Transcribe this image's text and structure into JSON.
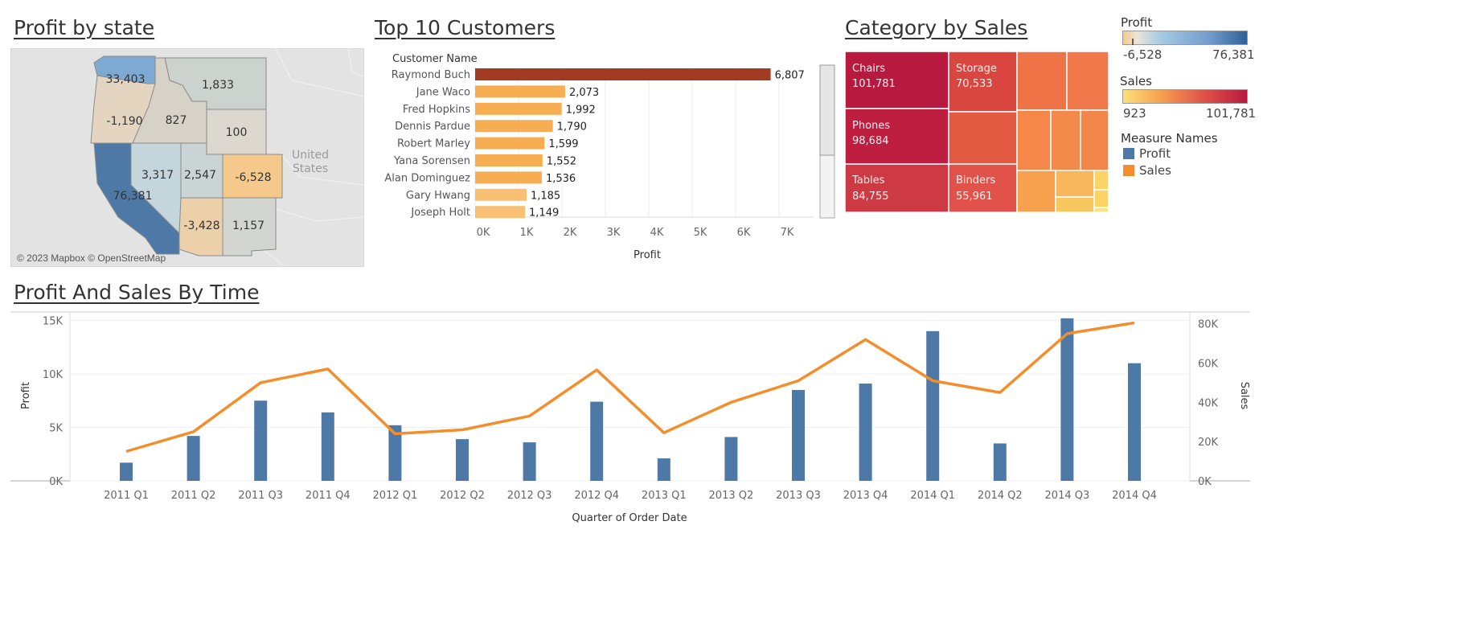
{
  "titles": {
    "map": "Profit by state",
    "customers": "Top 10 Customers",
    "category": "Category by Sales",
    "time": "Profit And Sales By Time"
  },
  "map": {
    "attribution": "© 2023 Mapbox © OpenStreetMap",
    "country_label": [
      "United",
      "States"
    ],
    "states": [
      {
        "name": "Washington",
        "profit": "33,403",
        "color": "#7ea9d3"
      },
      {
        "name": "Oregon",
        "profit": "-1,190",
        "color": "#e4d5c0"
      },
      {
        "name": "California",
        "profit": "76,381",
        "color": "#4e79a7"
      },
      {
        "name": "Idaho",
        "profit": "827",
        "color": "#d7d2c7"
      },
      {
        "name": "Montana",
        "profit": "1,833",
        "color": "#ccd3cf"
      },
      {
        "name": "Wyoming",
        "profit": "100",
        "color": "#dcd8cf"
      },
      {
        "name": "Nevada",
        "profit": "3,317",
        "color": "#c5d5dc"
      },
      {
        "name": "Utah",
        "profit": "2,547",
        "color": "#cad4d4"
      },
      {
        "name": "Colorado",
        "profit": "-6,528",
        "color": "#f5c98c"
      },
      {
        "name": "Arizona",
        "profit": "-3,428",
        "color": "#ecd0aa"
      },
      {
        "name": "New Mexico",
        "profit": "1,157",
        "color": "#d2d5d0"
      }
    ]
  },
  "customers_chart": {
    "row_header": "Customer Name",
    "x_axis_title": "Profit",
    "ticks": [
      "0K",
      "1K",
      "2K",
      "3K",
      "4K",
      "5K",
      "6K",
      "7K"
    ]
  },
  "treemap": {
    "tiles": [
      {
        "name": "Chairs",
        "value": "101,781"
      },
      {
        "name": "Storage",
        "value": "70,533"
      },
      {
        "name": "Phones",
        "value": "98,684"
      },
      {
        "name": "Tables",
        "value": "84,755"
      },
      {
        "name": "Binders",
        "value": "55,961"
      }
    ]
  },
  "legend": {
    "profit_title": "Profit",
    "profit_min": "-6,528",
    "profit_max": "76,381",
    "sales_title": "Sales",
    "sales_min": "923",
    "sales_max": "101,781",
    "measure_title": "Measure Names",
    "measure_items": [
      {
        "label": "Profit",
        "color": "#4e79a7"
      },
      {
        "label": "Sales",
        "color": "#f28e2b"
      }
    ]
  },
  "time_chart": {
    "x_axis_title": "Quarter of Order Date",
    "left_axis_title": "Profit",
    "right_axis_title": "Sales",
    "left_ticks": [
      "0K",
      "5K",
      "10K",
      "15K"
    ],
    "right_ticks": [
      "0K",
      "20K",
      "40K",
      "60K",
      "80K"
    ]
  },
  "chart_data": [
    {
      "type": "bar",
      "title": "Top 10 Customers",
      "xlabel": "Profit",
      "ylabel": "Customer Name",
      "orientation": "horizontal",
      "xlim": [
        0,
        8000
      ],
      "categories": [
        "Raymond Buch",
        "Jane Waco",
        "Fred Hopkins",
        "Dennis Pardue",
        "Robert Marley",
        "Yana Sorensen",
        "Alan Dominguez",
        "Gary Hwang",
        "Joseph Holt"
      ],
      "values": [
        6807,
        2073,
        1992,
        1790,
        1599,
        1552,
        1536,
        1185,
        1149
      ],
      "value_labels": [
        "6,807",
        "2,073",
        "1,992",
        "1,790",
        "1,599",
        "1,552",
        "1,536",
        "1,185",
        "1,149"
      ]
    },
    {
      "type": "bar",
      "title": "Profit And Sales By Time",
      "xlabel": "Quarter of Order Date",
      "categories": [
        "2011 Q1",
        "2011 Q2",
        "2011 Q3",
        "2011 Q4",
        "2012 Q1",
        "2012 Q2",
        "2012 Q3",
        "2012 Q4",
        "2013 Q1",
        "2013 Q2",
        "2013 Q3",
        "2013 Q4",
        "2014 Q1",
        "2014 Q2",
        "2014 Q3",
        "2014 Q4"
      ],
      "series": [
        {
          "name": "Profit",
          "type": "bar",
          "axis": "left",
          "color": "#4e79a7",
          "values": [
            1700,
            4200,
            7500,
            6400,
            5200,
            3900,
            3600,
            7400,
            2100,
            4100,
            8500,
            9100,
            14000,
            3500,
            15200,
            11000
          ]
        },
        {
          "name": "Sales",
          "type": "line",
          "axis": "right",
          "color": "#f28e2b",
          "values": [
            15000,
            25000,
            50000,
            57000,
            24000,
            26000,
            33000,
            56500,
            24500,
            40000,
            51000,
            72000,
            51000,
            45000,
            75000,
            80500
          ]
        }
      ],
      "ylabel": "Profit",
      "ylim": [
        0,
        15000
      ],
      "y2label": "Sales",
      "y2lim": [
        0,
        80000
      ],
      "grid": true
    }
  ]
}
